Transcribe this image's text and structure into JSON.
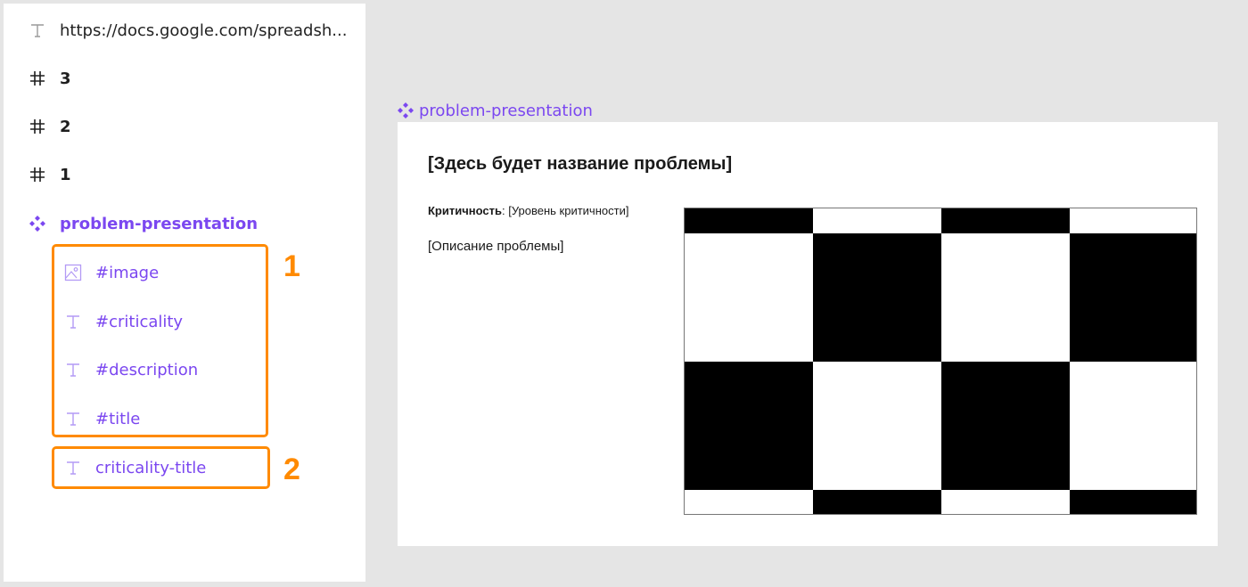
{
  "layers": {
    "items": [
      {
        "label": "https://docs.google.com/spreadsh...",
        "icon": "text-icon"
      },
      {
        "label": "3",
        "icon": "frame-hash-icon"
      },
      {
        "label": "2",
        "icon": "frame-hash-icon"
      },
      {
        "label": "1",
        "icon": "frame-hash-icon"
      },
      {
        "label": "problem-presentation",
        "icon": "component-icon"
      },
      {
        "label": "#image",
        "icon": "image-icon"
      },
      {
        "label": "#criticality",
        "icon": "text-icon"
      },
      {
        "label": "#description",
        "icon": "text-icon"
      },
      {
        "label": "#title",
        "icon": "text-icon"
      },
      {
        "label": "criticality-title",
        "icon": "text-icon"
      }
    ]
  },
  "callouts": {
    "one": "1",
    "two": "2"
  },
  "canvas": {
    "frame_label": "problem-presentation",
    "title": "[Здесь будет название проблемы]",
    "criticality_label": "Критичность",
    "criticality_sep": ":",
    "criticality_value": "[Уровень критичности]",
    "description": "[Описание проблемы]"
  },
  "colors": {
    "accent": "#7b47f0",
    "highlight": "#ff8a00",
    "canvas_bg": "#e5e5e5"
  }
}
